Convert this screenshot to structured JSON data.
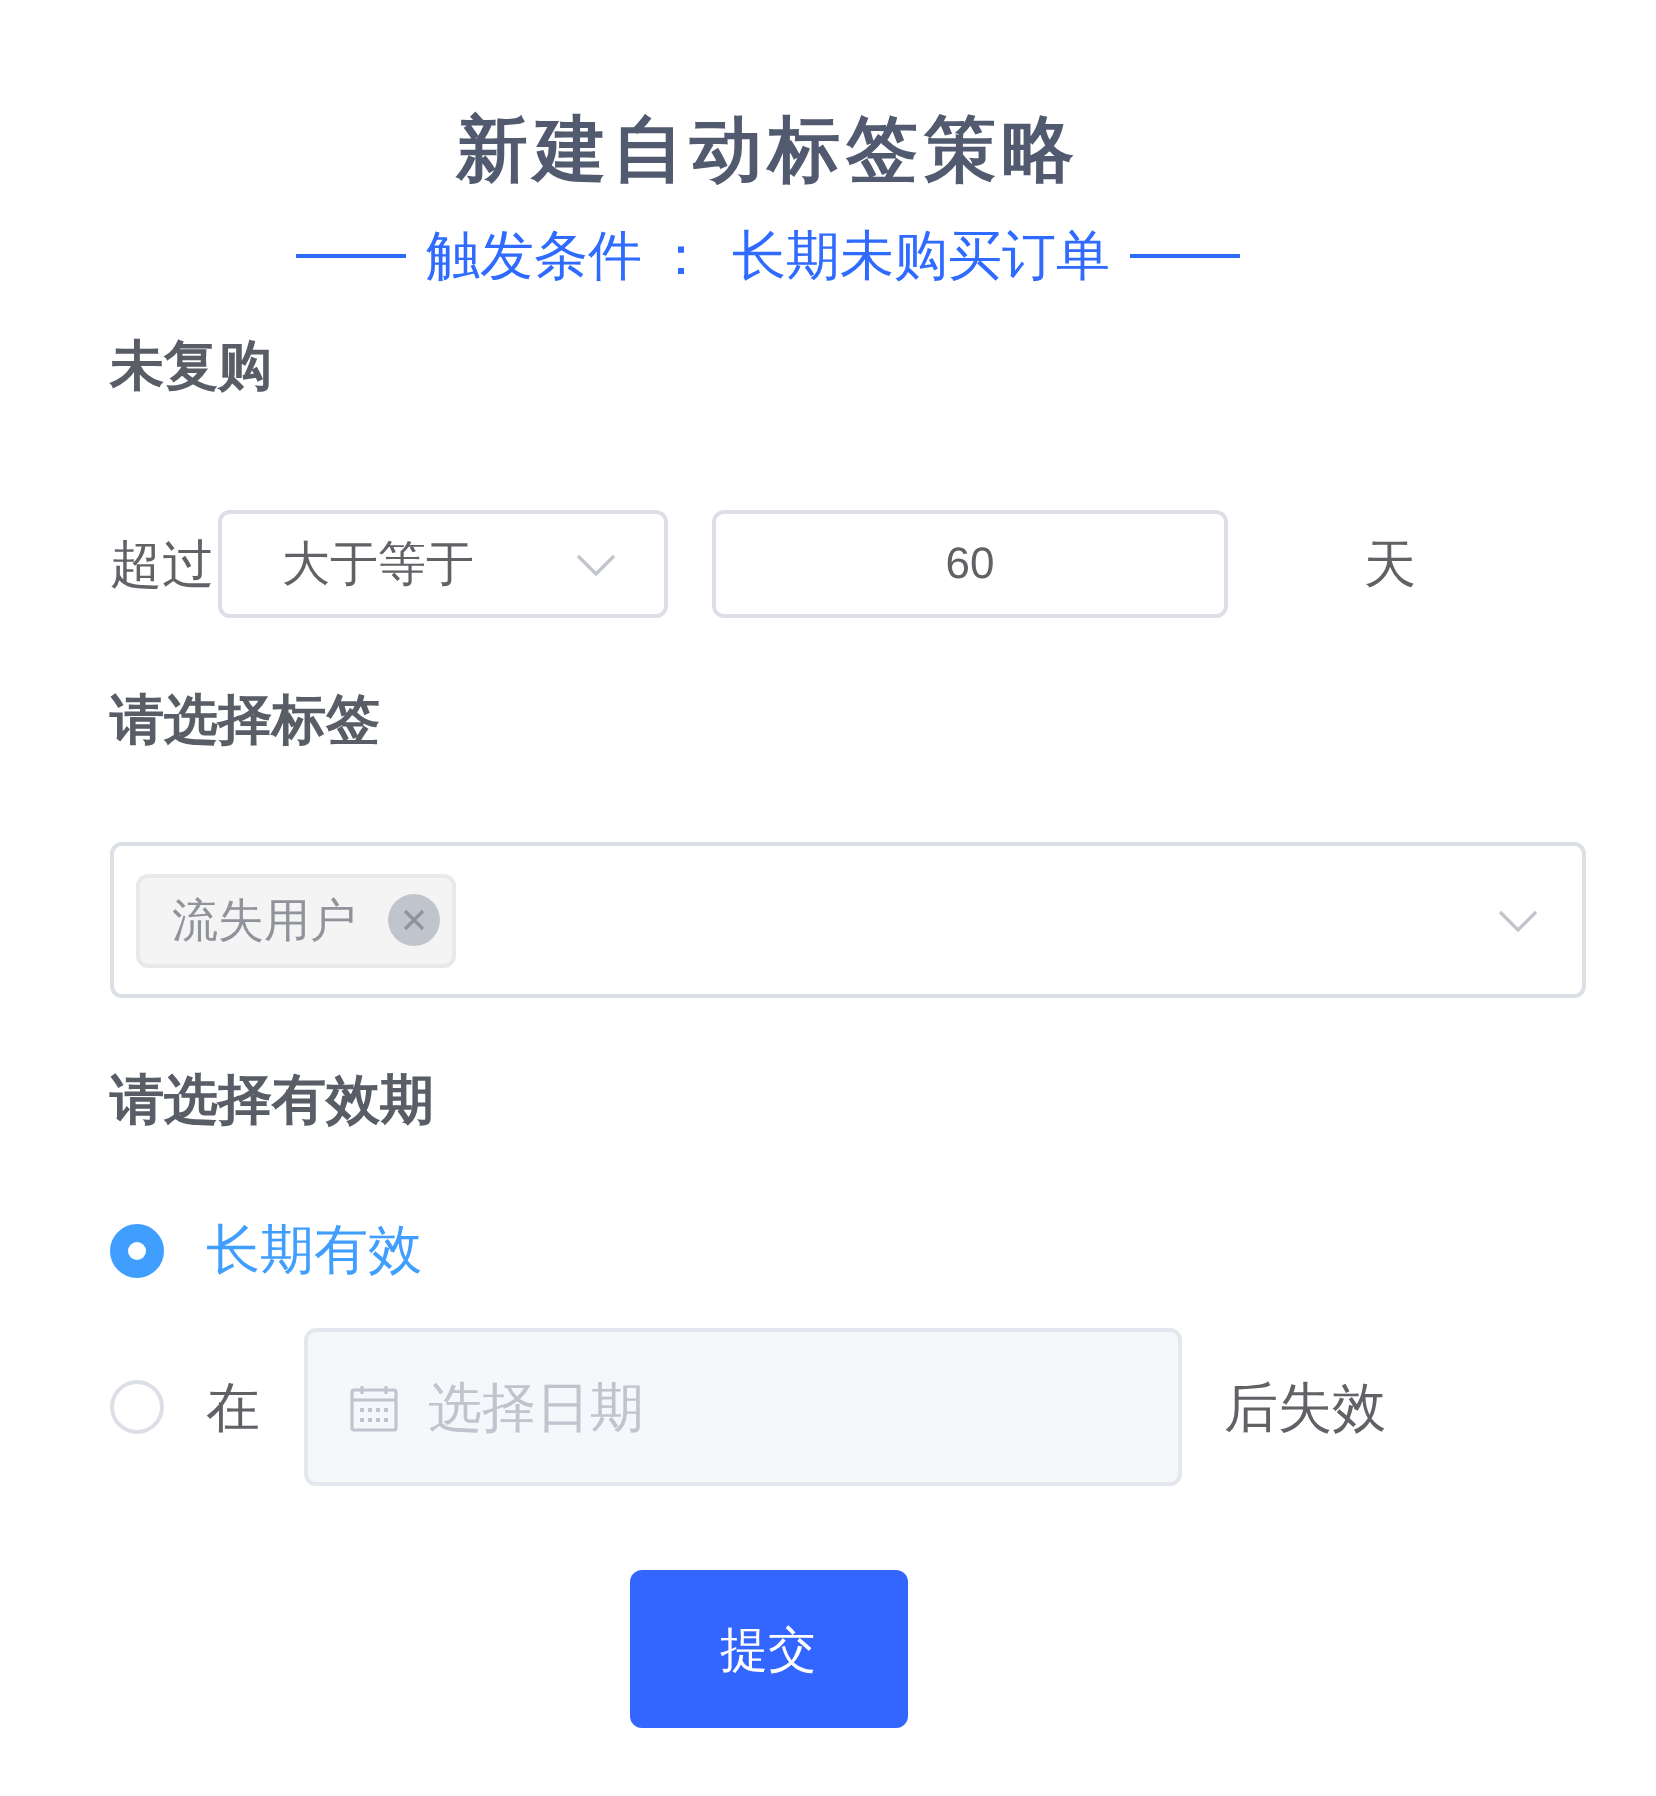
{
  "title": "新建自动标签策略",
  "trigger": {
    "label": "触发条件",
    "separator": "：",
    "value": "长期未购买订单"
  },
  "repurchase": {
    "heading": "未复购",
    "prefix": "超过",
    "operator": {
      "value": "大于等于"
    },
    "days": {
      "value": "60"
    },
    "unit": "天"
  },
  "tags": {
    "heading": "请选择标签",
    "selected": [
      {
        "label": "流失用户"
      }
    ]
  },
  "validity": {
    "heading": "请选择有效期",
    "options": [
      {
        "kind": "forever",
        "label": "长期有效",
        "selected": true
      },
      {
        "kind": "until_date",
        "prefix": "在",
        "date": {
          "placeholder": "选择日期",
          "disabled": true
        },
        "suffix": "后失效",
        "selected": false
      }
    ]
  },
  "submit": {
    "label": "提交"
  }
}
